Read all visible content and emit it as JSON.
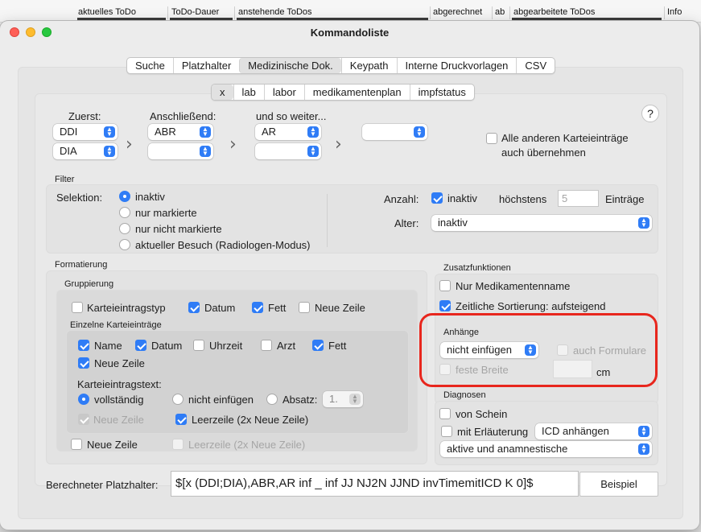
{
  "background": {
    "columns": [
      {
        "label": "aktuelles ToDo"
      },
      {
        "label": "ToDo-Dauer"
      },
      {
        "label": "anstehende ToDos"
      },
      {
        "label": "abgerechnet"
      },
      {
        "label": "ab"
      },
      {
        "label": "abgearbeitete ToDos"
      },
      {
        "label": "Info"
      }
    ]
  },
  "window": {
    "title": "Kommandoliste"
  },
  "main_tabs": [
    {
      "label": "Suche"
    },
    {
      "label": "Platzhalter"
    },
    {
      "label": "Medizinische Dok."
    },
    {
      "label": "Keypath"
    },
    {
      "label": "Interne Druckvorlagen"
    },
    {
      "label": "CSV"
    }
  ],
  "main_tab_selected": "Medizinische Dok.",
  "sub_tabs": [
    {
      "label": "x"
    },
    {
      "label": "lab"
    },
    {
      "label": "labor"
    },
    {
      "label": "medikamentenplan"
    },
    {
      "label": "impfstatus"
    }
  ],
  "sub_tab_selected": "x",
  "help": "?",
  "order": {
    "first_label": "Zuerst:",
    "first_values": [
      "DDI",
      "DIA"
    ],
    "then_label": "Anschließend:",
    "then_values": [
      "ABR",
      ""
    ],
    "more_label": "und so weiter...",
    "more_values": [
      "AR",
      ""
    ],
    "last_value": "",
    "take_all_label": "Alle anderen Karteieinträge auch übernehmen",
    "take_all_line1": "Alle anderen Karteieinträge",
    "take_all_line2": "auch übernehmen",
    "take_all_checked": false
  },
  "filter": {
    "title": "Filter",
    "selection_label": "Selektion:",
    "selection_options": [
      "inaktiv",
      "nur markierte",
      "nur nicht markierte",
      "aktueller Besuch (Radiologen-Modus)"
    ],
    "selection_selected": "inaktiv",
    "count_label": "Anzahl:",
    "count_checkbox": "inaktiv",
    "count_checked": true,
    "max_label": "höchstens",
    "max_value": "5",
    "entries_label": "Einträge",
    "age_label": "Alter:",
    "age_value": "inaktiv"
  },
  "formatting": {
    "title": "Formatierung",
    "grouping": {
      "title": "Gruppierung",
      "options": [
        {
          "label": "Karteieintragstyp",
          "checked": false
        },
        {
          "label": "Datum",
          "checked": true
        },
        {
          "label": "Fett",
          "checked": true
        },
        {
          "label": "Neue Zeile",
          "checked": false
        }
      ]
    },
    "single": {
      "title": "Einzelne Karteieinträge",
      "options": [
        {
          "label": "Name",
          "checked": true
        },
        {
          "label": "Datum",
          "checked": true
        },
        {
          "label": "Uhrzeit",
          "checked": false
        },
        {
          "label": "Arzt",
          "checked": false
        },
        {
          "label": "Fett",
          "checked": true
        },
        {
          "label": "Neue Zeile",
          "checked": true
        }
      ],
      "text_label": "Karteieintragstext:",
      "text_options": [
        "vollständig",
        "nicht einfügen",
        "Absatz:"
      ],
      "text_selected": "vollständig",
      "absatz_value": "1.",
      "neue_zeile_disabled": "Neue Zeile",
      "neue_zeile_disabled_checked": true,
      "leerzeile": "Leerzeile (2x Neue Zeile)",
      "leerzeile_checked": true
    },
    "bottom_neue_zeile": "Neue Zeile",
    "bottom_neue_zeile_checked": false,
    "bottom_leerzeile": "Leerzeile (2x Neue Zeile)",
    "bottom_leerzeile_checked": false
  },
  "extras": {
    "title": "Zusatzfunktionen",
    "options": [
      {
        "label": "Nur Medikamentenname",
        "checked": false
      },
      {
        "label": "Zeitliche Sortierung: aufsteigend",
        "checked": true
      }
    ]
  },
  "attachments": {
    "title": "Anhänge",
    "select_value": "nicht einfügen",
    "also_forms": "auch Formulare",
    "fixed_width": "feste Breite",
    "width_value": "",
    "unit": "cm"
  },
  "diagnoses": {
    "title": "Diagnosen",
    "from_bill": "von Schein",
    "from_bill_checked": false,
    "with_explanation": "mit Erläuterung",
    "with_explanation_checked": false,
    "icd_value": "ICD anhängen",
    "type_value": "aktive und anamnestische"
  },
  "computed": {
    "label": "Berechneter Platzhalter:",
    "value": "$[x (DDI;DIA),ABR,AR inf _ inf JJ NJ2N JJND invTimemitICD K 0]$",
    "example_button": "Beispiel"
  },
  "colors": {
    "accent": "#2f7cf6",
    "highlight": "#e8261d"
  }
}
